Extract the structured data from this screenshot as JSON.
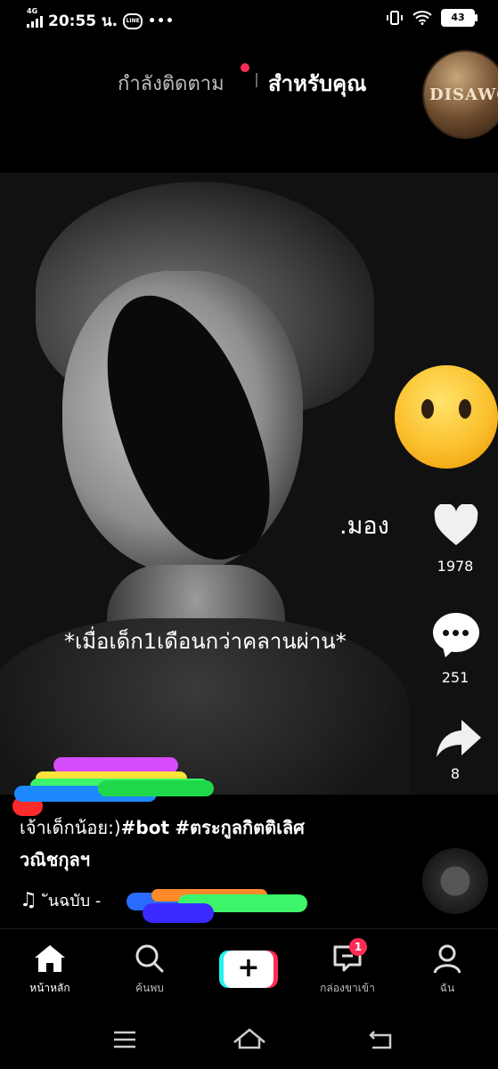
{
  "status_bar": {
    "network": "4G",
    "time": "20:55 น.",
    "battery": "43"
  },
  "top_nav": {
    "following_label": "กำลังติดตาม",
    "for_you_label": "สำหรับคุณ",
    "live_avatar_text": "DISAWO"
  },
  "video": {
    "overlay_text_1": ".มอง",
    "overlay_text_2": "*เมื่อเด็ก1เดือนกว่าคลานผ่าน*"
  },
  "actions": {
    "like_count": "1978",
    "comment_count": "251",
    "share_count": "8"
  },
  "caption": {
    "text_plain": "เจ้าเด็กน้อย:)",
    "hashtag_1": "#bot",
    "hashtag_2": "#ตระกูลกิตติเลิศ",
    "line2": "วณิชกุลฯ"
  },
  "music": {
    "title": "ันฉบับ -"
  },
  "bottom_nav": {
    "home": "หน้าหลัก",
    "discover": "ค้นพบ",
    "inbox": "กล่องขาเข้า",
    "inbox_badge": "1",
    "profile": "ฉัน"
  }
}
